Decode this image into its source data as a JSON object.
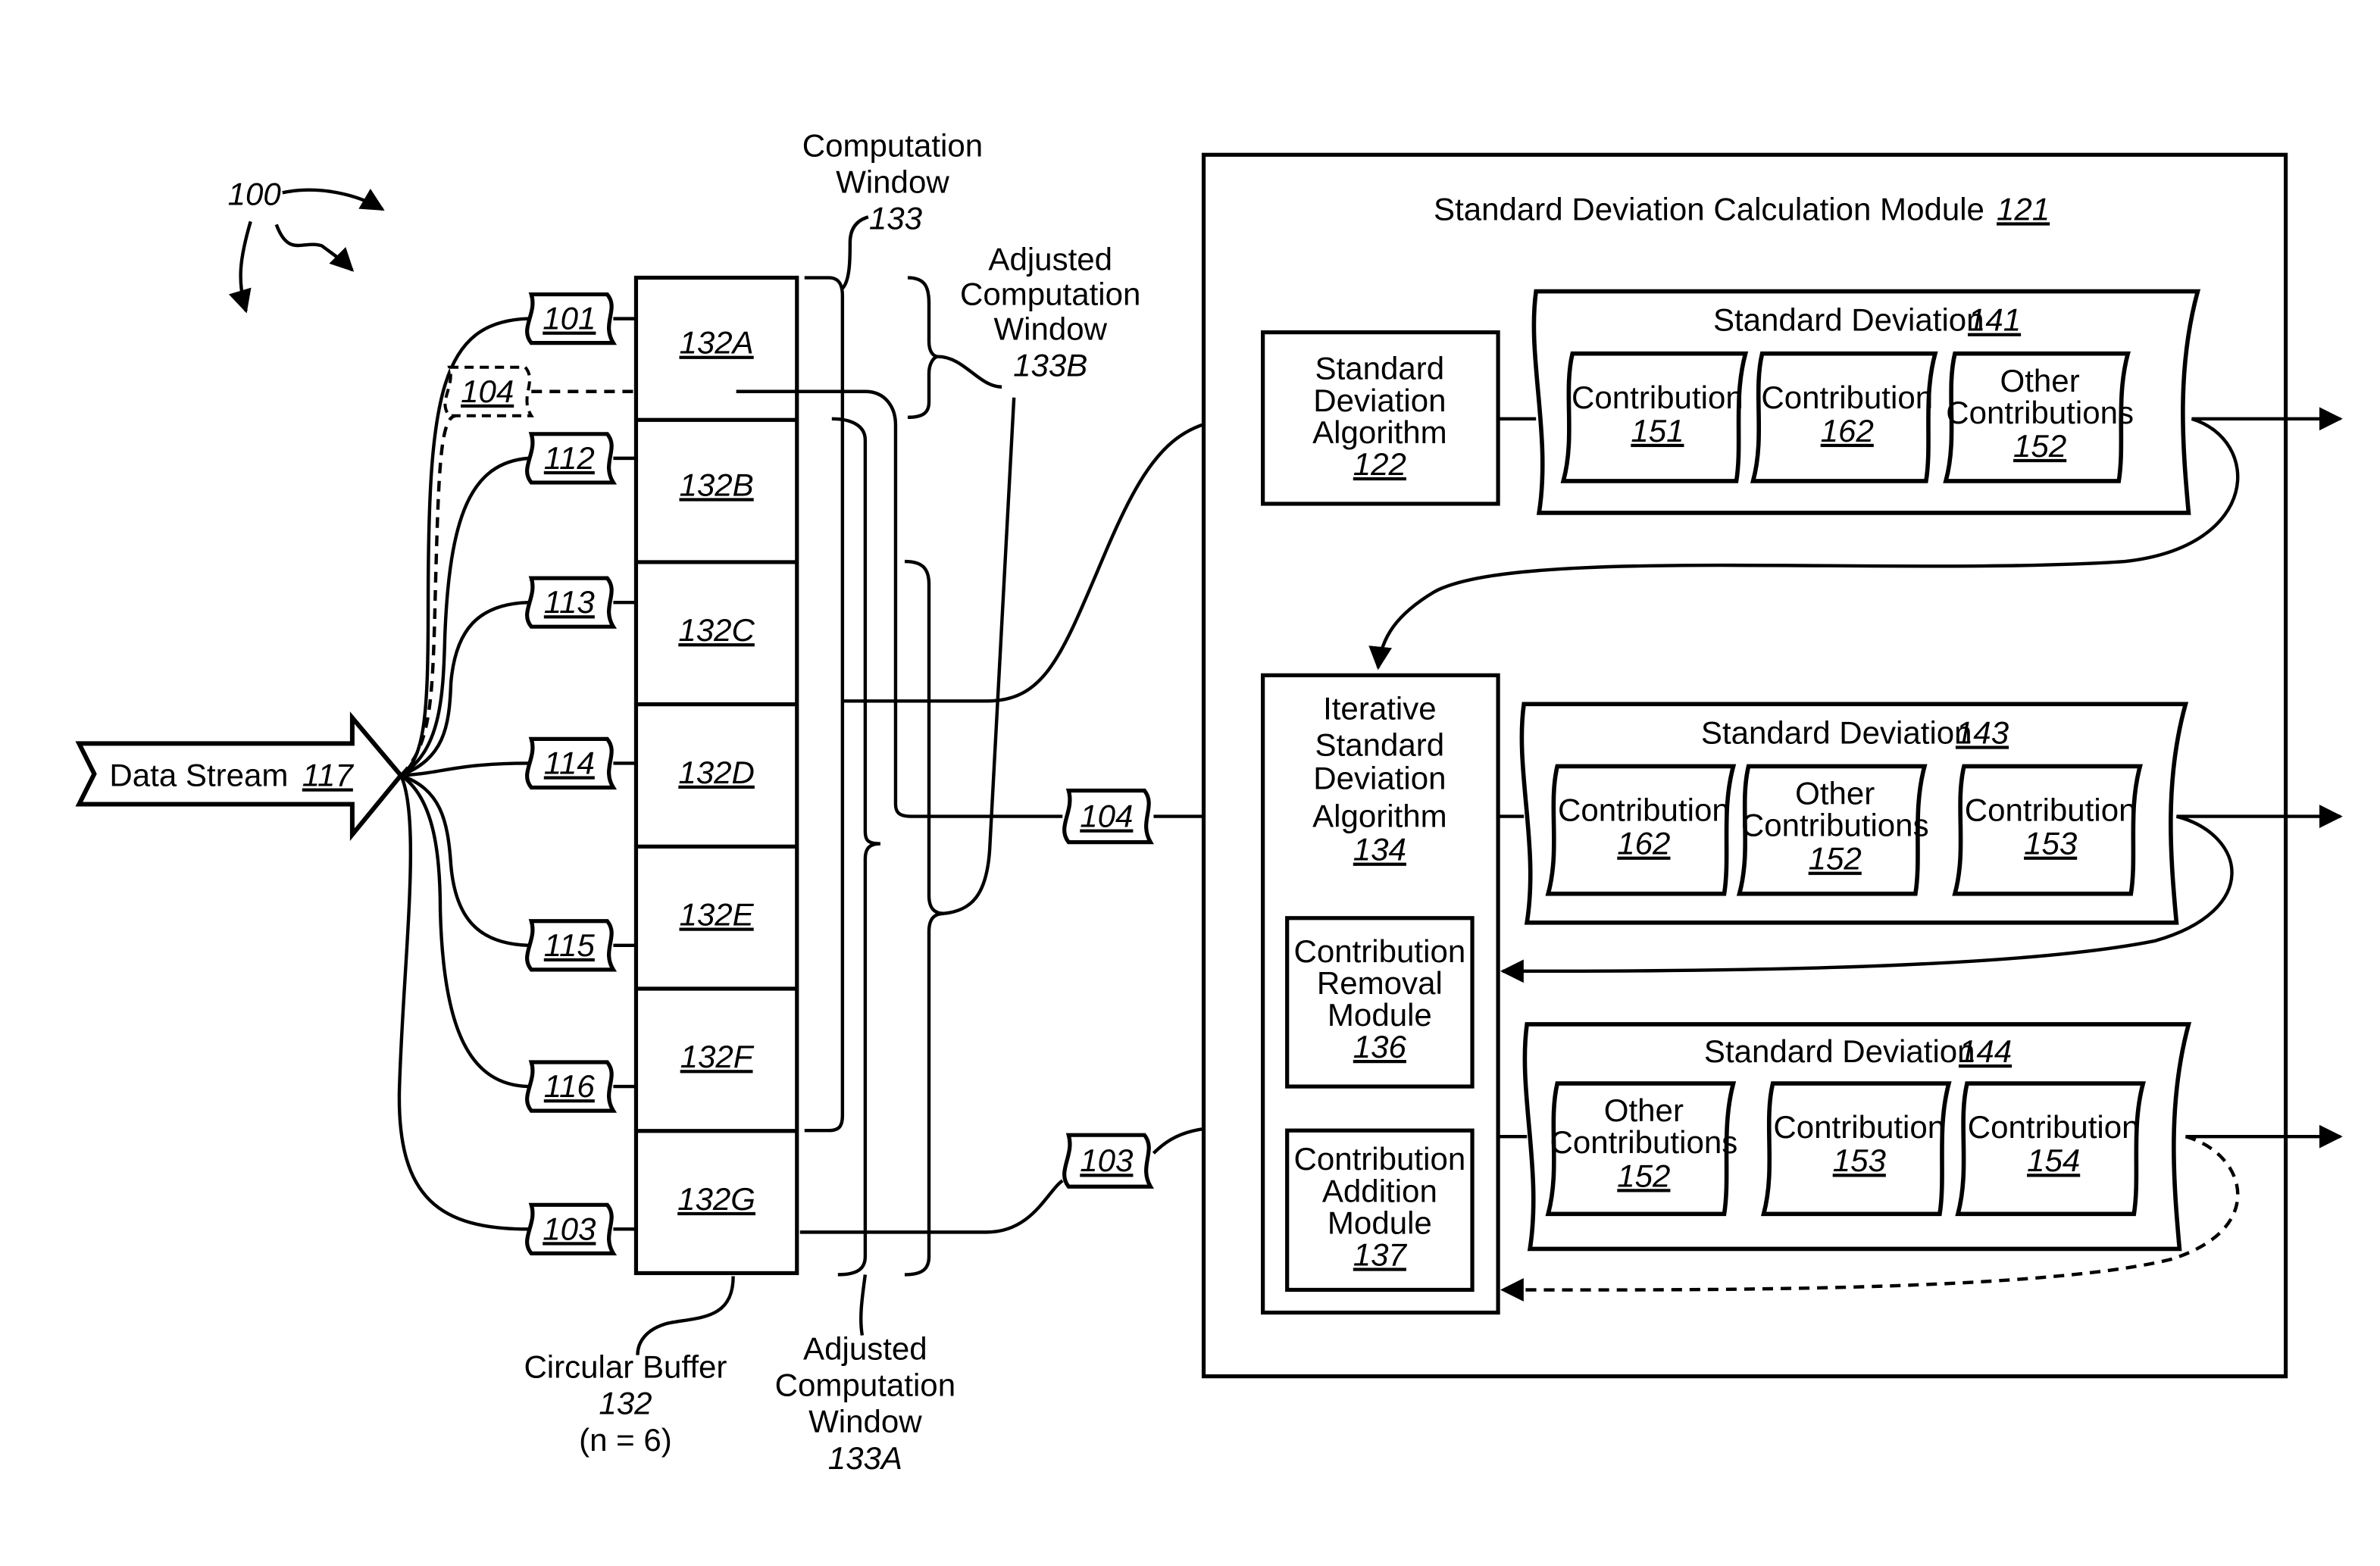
{
  "figure": {
    "ref": "100",
    "data_stream": {
      "label": "Data Stream",
      "ref": "117"
    },
    "inputs": [
      {
        "ref": "101",
        "target": "132A"
      },
      {
        "ref": "104",
        "target": "132A",
        "dashed": true
      },
      {
        "ref": "112",
        "target": "132B"
      },
      {
        "ref": "113",
        "target": "132C"
      },
      {
        "ref": "114",
        "target": "132D"
      },
      {
        "ref": "115",
        "target": "132E"
      },
      {
        "ref": "116",
        "target": "132F"
      },
      {
        "ref": "103",
        "target": "132G"
      }
    ],
    "buffer": {
      "cells": [
        "132A",
        "132B",
        "132C",
        "132D",
        "132E",
        "132F",
        "132G"
      ],
      "label": "Circular Buffer",
      "ref": "132",
      "note": "(n = 6)"
    },
    "windows": {
      "w133": {
        "line1": "Computation",
        "line2": "Window",
        "ref": "133"
      },
      "w133b": {
        "line1": "Adjusted",
        "line2": "Computation",
        "line3": "Window",
        "ref": "133B"
      },
      "w133a": {
        "line1": "Adjusted",
        "line2": "Computation",
        "line3": "Window",
        "ref": "133A"
      }
    },
    "mid_tags": {
      "t104": "104",
      "t103": "103"
    },
    "module": {
      "title": "Standard Deviation Calculation Module",
      "ref": "121",
      "sd_algorithm": {
        "line1": "Standard",
        "line2": "Deviation",
        "line3": "Algorithm",
        "ref": "122"
      },
      "iter_algorithm": {
        "line1": "Iterative",
        "line2": "Standard",
        "line3": "Deviation",
        "line4": "Algorithm",
        "ref": "134"
      },
      "removal": {
        "line1": "Contribution",
        "line2": "Removal",
        "line3": "Module",
        "ref": "136"
      },
      "addition": {
        "line1": "Contribution",
        "line2": "Addition",
        "line3": "Module",
        "ref": "137"
      },
      "sd141": {
        "title": "Standard Deviation",
        "ref": "141",
        "items": [
          {
            "line1": "Contribution",
            "line2": "",
            "ref": "151"
          },
          {
            "line1": "Contribution",
            "line2": "",
            "ref": "162"
          },
          {
            "line1": "Other",
            "line2": "Contributions",
            "ref": "152"
          }
        ]
      },
      "sd143": {
        "title": "Standard Deviation",
        "ref": "143",
        "items": [
          {
            "line1": "Contribution",
            "line2": "",
            "ref": "162"
          },
          {
            "line1": "Other",
            "line2": "Contributions",
            "ref": "152"
          },
          {
            "line1": "Contribution",
            "line2": "",
            "ref": "153"
          }
        ]
      },
      "sd144": {
        "title": "Standard Deviation",
        "ref": "144",
        "items": [
          {
            "line1": "Other",
            "line2": "Contributions",
            "ref": "152"
          },
          {
            "line1": "Contribution",
            "line2": "",
            "ref": "153"
          },
          {
            "line1": "Contribution",
            "line2": "",
            "ref": "154"
          }
        ]
      }
    }
  }
}
